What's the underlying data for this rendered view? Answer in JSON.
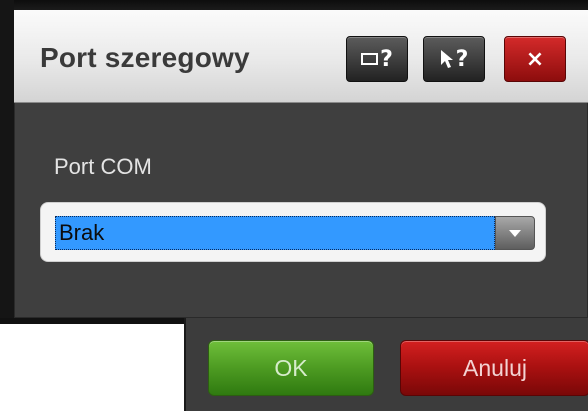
{
  "dialog": {
    "title": "Port szeregowy",
    "title_buttons": [
      {
        "name": "window-help-button",
        "icon": "window-question-icon",
        "symbol": "?"
      },
      {
        "name": "pointer-help-button",
        "icon": "pointer-question-icon",
        "symbol": "?"
      },
      {
        "name": "close-button",
        "icon": "close-icon",
        "symbol": "×"
      }
    ]
  },
  "form": {
    "port_label": "Port COM",
    "port_select": {
      "selected_value": "Brak"
    }
  },
  "footer": {
    "ok_label": "OK",
    "cancel_label": "Anuluj"
  },
  "colors": {
    "dialog_bg": "#3f3f3f",
    "selection_blue": "#3399ff",
    "ok_green": "#4d9b22",
    "cancel_red": "#a81010",
    "close_red": "#c01a1a"
  }
}
